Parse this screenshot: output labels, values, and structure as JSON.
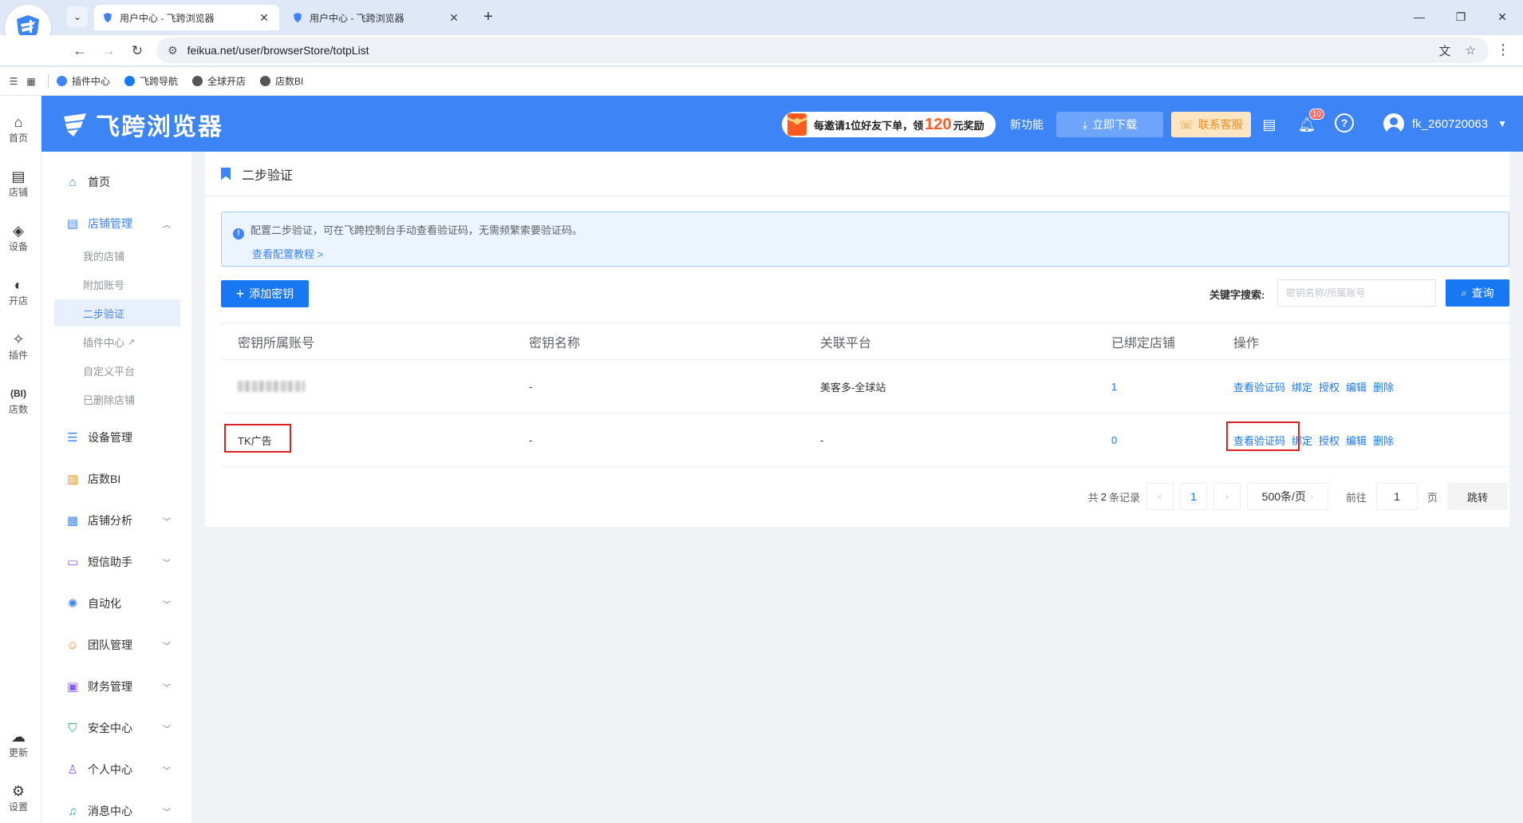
{
  "browser": {
    "tabs": [
      {
        "title": "用户中心 - 飞跨浏览器",
        "active": true
      },
      {
        "title": "用户中心 - 飞跨浏览器",
        "active": false
      }
    ],
    "url": "feikua.net/user/browserStore/totpList",
    "bookmarks": [
      {
        "label": "插件中心",
        "color": "#3d84f7"
      },
      {
        "label": "飞跨导航",
        "color": "#1877f2"
      },
      {
        "label": "全球开店",
        "color": "#555555"
      },
      {
        "label": "店数BI",
        "color": "#555555"
      }
    ]
  },
  "rail": {
    "items": [
      {
        "label": "首页",
        "icon": "home-icon"
      },
      {
        "label": "店铺",
        "icon": "store-icon"
      },
      {
        "label": "设备",
        "icon": "layers-icon"
      },
      {
        "label": "开店",
        "icon": "planet-icon"
      },
      {
        "label": "插件",
        "icon": "puzzle-icon"
      },
      {
        "label": "店数",
        "icon": "bi-icon"
      }
    ],
    "bottom": [
      {
        "label": "更新",
        "icon": "cloud-update-icon"
      },
      {
        "label": "设置",
        "icon": "settings-icon"
      }
    ]
  },
  "header": {
    "brand": "飞跨浏览器",
    "promo_prefix": "每邀请1位好友下单，领",
    "promo_amount": "120",
    "promo_suffix": "元奖励",
    "new_features": "新功能",
    "download": "立即下载",
    "contact": "联系客服",
    "notification_count": "10",
    "username": "fk_260720063",
    "brand_color": "#3d84f7"
  },
  "sidemenu": {
    "home": "首页",
    "store_mgmt": "店铺管理",
    "store_sub": [
      "我的店铺",
      "附加账号",
      "二步验证",
      "插件中心",
      "自定义平台",
      "已删除店铺"
    ],
    "device_mgmt": "设备管理",
    "store_bi": "店数BI",
    "store_analysis": "店铺分析",
    "sms": "短信助手",
    "automation": "自动化",
    "team": "团队管理",
    "finance": "财务管理",
    "security": "安全中心",
    "personal": "个人中心",
    "messages": "消息中心"
  },
  "page": {
    "title": "二步验证",
    "alert_text": "配置二步验证，可在飞跨控制台手动查看验证码，无需频繁索要验证码。",
    "alert_link": "查看配置教程 >",
    "add_button": "添加密钥",
    "keyword_label": "关键字搜索:",
    "keyword_placeholder": "密钥名称/所属账号",
    "search_button": "查询"
  },
  "table": {
    "headers": [
      "密钥所属账号",
      "密钥名称",
      "关联平台",
      "已绑定店铺",
      "操作"
    ],
    "rows": [
      {
        "account": "",
        "key_name": "-",
        "platform": "美客多-全球站",
        "bound": "1"
      },
      {
        "account": "TK广告",
        "key_name": "-",
        "platform": "-",
        "bound": "0"
      }
    ],
    "actions": [
      "查看验证码",
      "绑定",
      "授权",
      "编辑",
      "删除"
    ]
  },
  "pagination": {
    "total_prefix": "共",
    "total": "2",
    "total_suffix": "条记录",
    "current_page": "1",
    "page_size": "500条/页",
    "goto_label": "前往",
    "goto_value": "1",
    "page_unit": "页",
    "jump": "跳转"
  }
}
